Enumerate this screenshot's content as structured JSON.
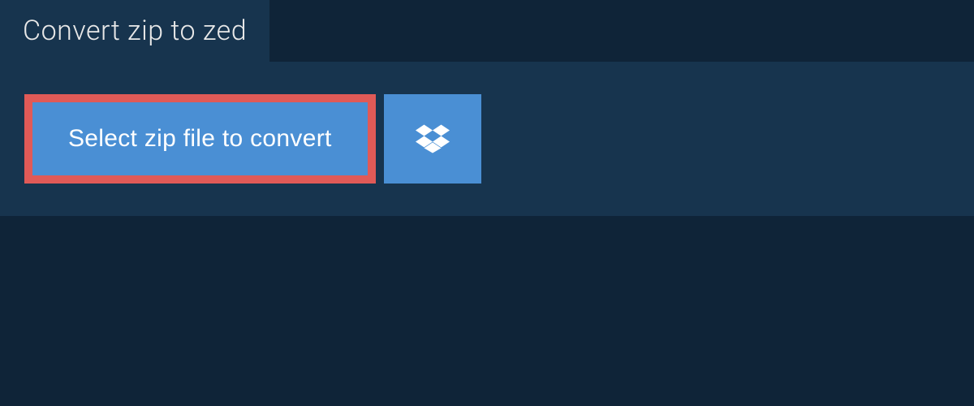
{
  "header": {
    "title": "Convert zip to zed"
  },
  "actions": {
    "select_label": "Select zip file to convert",
    "dropbox_icon": "dropbox"
  },
  "colors": {
    "bg_dark": "#0f2438",
    "panel": "#17344e",
    "button_blue": "#4a8fd4",
    "highlight_red": "#e05a57",
    "text_light": "#e8e8e8",
    "text_white": "#ffffff"
  }
}
